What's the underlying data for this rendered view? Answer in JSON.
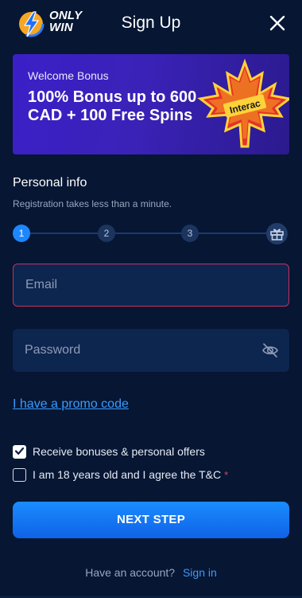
{
  "header": {
    "logo_line1": "ONLY",
    "logo_line2": "WIN",
    "title": "Sign Up",
    "close_icon": "close-icon"
  },
  "banner": {
    "subtitle": "Welcome Bonus",
    "headline": "100% Bonus up to 600 CAD + 100 Free Spins",
    "badge_text": "Interac",
    "colors": {
      "bg_start": "#3b1fc7",
      "leaf": "#e8312a",
      "leaf_highlight": "#ffd23a"
    }
  },
  "section": {
    "title": "Personal info",
    "subtitle": "Registration takes less than a minute."
  },
  "stepper": {
    "steps": [
      "1",
      "2",
      "3"
    ],
    "active_index": 0,
    "final_icon": "gift-icon"
  },
  "form": {
    "email_placeholder": "Email",
    "email_value": "",
    "password_placeholder": "Password",
    "password_value": "",
    "toggle_visibility_icon": "eye-off-icon",
    "promo_link": "I have a promo code"
  },
  "checkboxes": [
    {
      "label": "Receive bonuses & personal offers",
      "checked": true,
      "required": false
    },
    {
      "label": "I am 18 years old and I agree the T&C",
      "checked": false,
      "required": true,
      "required_mark": "*"
    }
  ],
  "actions": {
    "next_step": "NEXT STEP"
  },
  "footer": {
    "prompt": "Have an account?",
    "signin_link": "Sign in"
  },
  "colors": {
    "background": "#061633",
    "accent": "#1d87ff",
    "link": "#3a9bff",
    "error_border": "#c9305a"
  }
}
